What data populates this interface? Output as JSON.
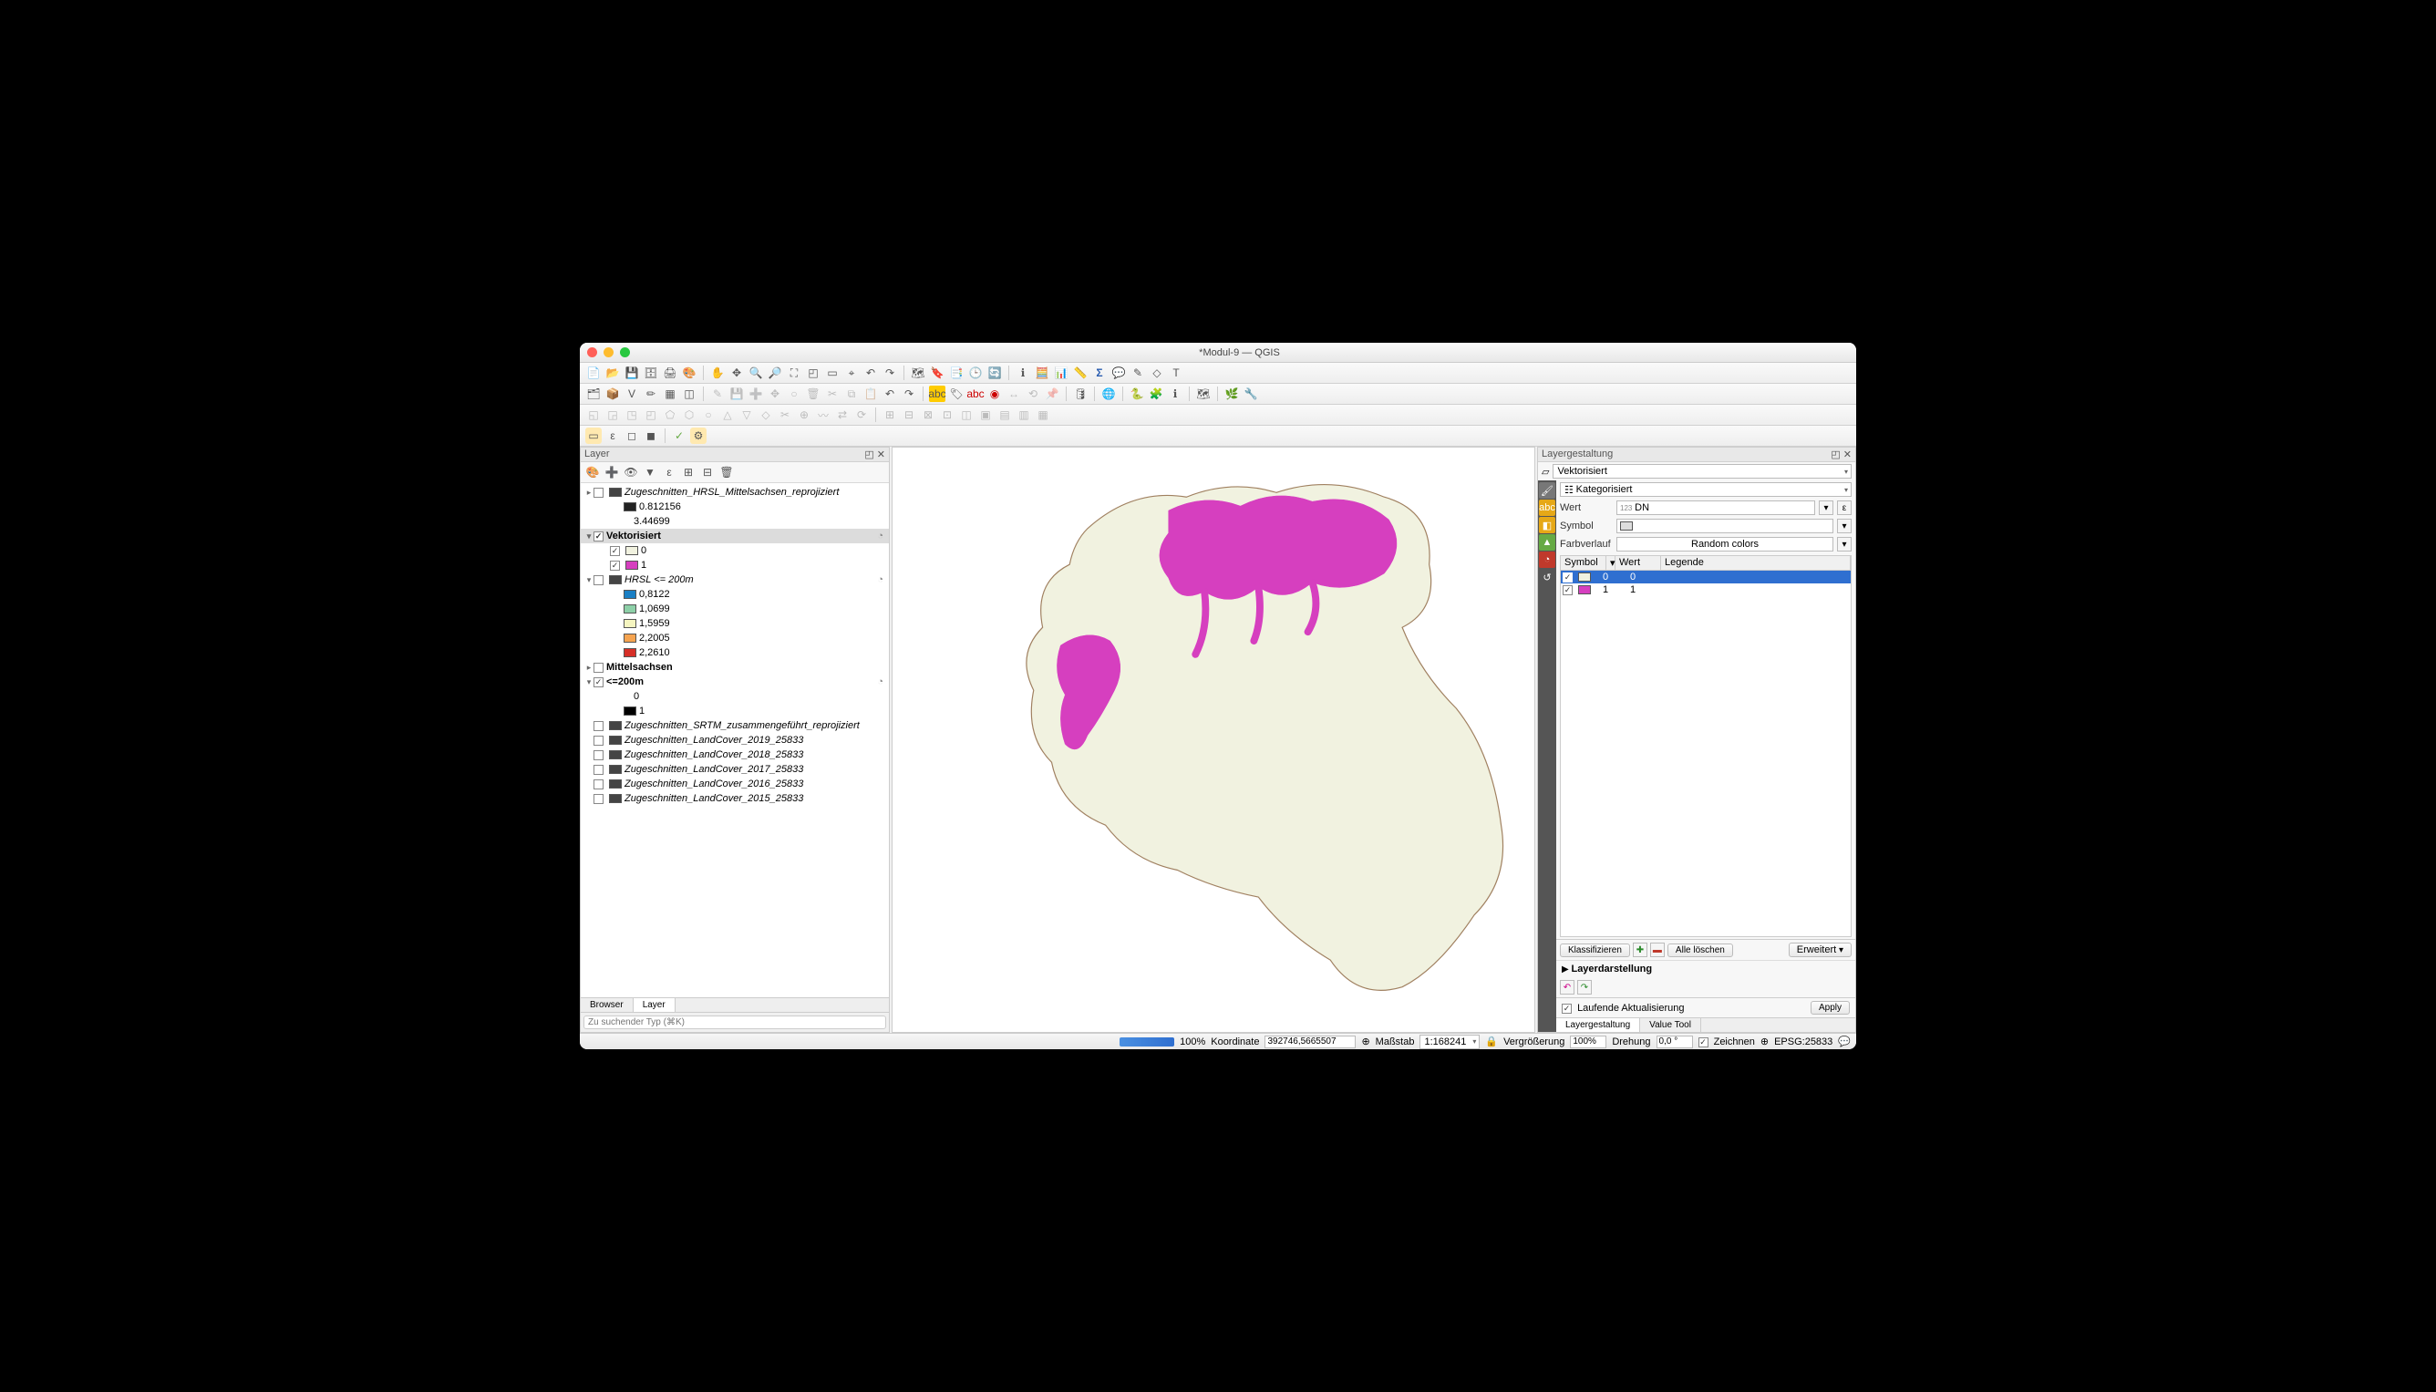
{
  "window": {
    "title": "*Modul-9 — QGIS"
  },
  "panels": {
    "layers_title": "Layer",
    "styling_title": "Layergestaltung"
  },
  "layers": {
    "l1_name": "Zugeschnitten_HRSL_Mittelsachsen_reprojiziert",
    "l1_v1": "0.812156",
    "l1_v2": "3.44699",
    "l2_name": "Vektorisiert",
    "l2_v1": "0",
    "l2_v2": "1",
    "l3_name": "HRSL <= 200m",
    "l3_v1": "0,8122",
    "l3_v2": "1,0699",
    "l3_v3": "1,5959",
    "l3_v4": "2,2005",
    "l3_v5": "2,2610",
    "l4_name": "Mittelsachsen",
    "l5_name": "<=200m",
    "l5_v1": "0",
    "l5_v2": "1",
    "l6_name": "Zugeschnitten_SRTM_zusammengeführt_reprojiziert",
    "l7_name": "Zugeschnitten_LandCover_2019_25833",
    "l8_name": "Zugeschnitten_LandCover_2018_25833",
    "l9_name": "Zugeschnitten_LandCover_2017_25833",
    "l10_name": "Zugeschnitten_LandCover_2016_25833",
    "l11_name": "Zugeschnitten_LandCover_2015_25833"
  },
  "tabs": {
    "browser": "Browser",
    "layer": "Layer"
  },
  "search": {
    "placeholder": "Zu suchender Typ (⌘K)"
  },
  "styling": {
    "layer_value": "Vektorisiert",
    "renderer": "Kategorisiert",
    "wert_label": "Wert",
    "wert_value": "DN",
    "wert_prefix": "123",
    "symbol_label": "Symbol",
    "ramp_label": "Farbverlauf",
    "ramp_value": "Random colors",
    "head_symbol": "Symbol",
    "head_wert": "Wert",
    "head_legende": "Legende",
    "row0_wert": "0",
    "row0_leg": "0",
    "row1_wert": "1",
    "row1_leg": "1",
    "classify": "Klassifizieren",
    "delete_all": "Alle löschen",
    "advanced": "Erweitert",
    "layer_render": "Layerdarstellung",
    "live_update": "Laufende Aktualisierung",
    "apply": "Apply",
    "tab_styling": "Layergestaltung",
    "tab_value": "Value Tool"
  },
  "status": {
    "progress_text": "100%",
    "coord_label": "Koordinate",
    "coord_value": "392746,5665507",
    "scale_label": "Maßstab",
    "scale_value": "1:168241",
    "mag_label": "Vergrößerung",
    "mag_value": "100%",
    "rot_label": "Drehung",
    "rot_value": "0,0 °",
    "render": "Zeichnen",
    "crs": "EPSG:25833"
  },
  "colors": {
    "magenta": "#d63fbf",
    "cream": "#f1f2e0",
    "outline": "#a08060",
    "blue_sel": "#2f6fd0"
  }
}
